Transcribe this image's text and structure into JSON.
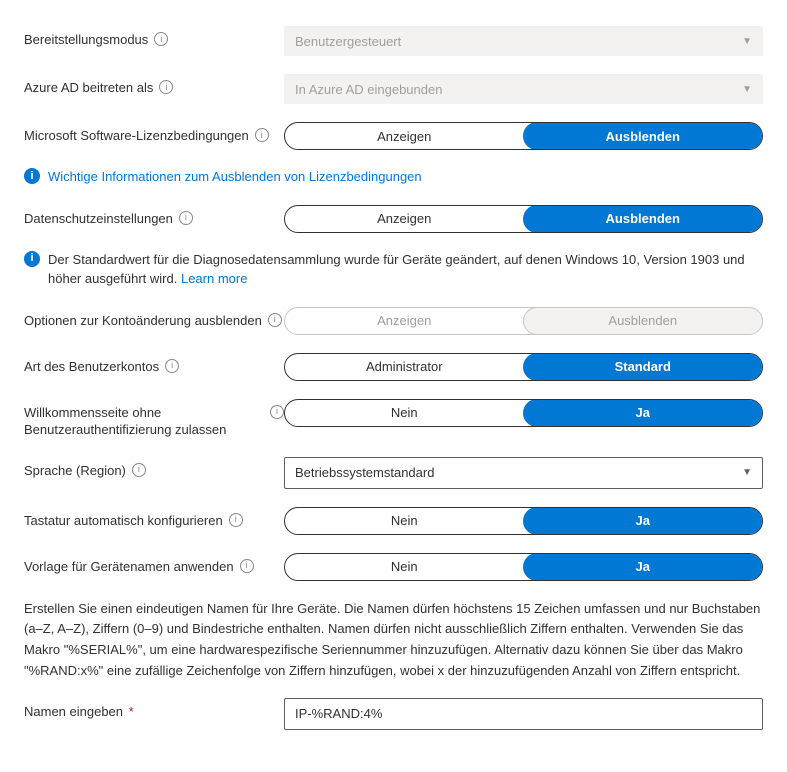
{
  "rows": {
    "deployMode": {
      "label": "Bereitstellungsmodus",
      "value": "Benutzergesteuert"
    },
    "azureAdJoin": {
      "label": "Azure AD beitreten als",
      "value": "In Azure AD eingebunden"
    },
    "eula": {
      "label": "Microsoft Software-Lizenzbedingungen",
      "optA": "Anzeigen",
      "optB": "Ausblenden"
    },
    "privacy": {
      "label": "Datenschutzeinstellungen",
      "optA": "Anzeigen",
      "optB": "Ausblenden"
    },
    "acctChange": {
      "label": "Optionen zur Kontoänderung ausblenden",
      "optA": "Anzeigen",
      "optB": "Ausblenden"
    },
    "acctType": {
      "label": "Art des Benutzerkontos",
      "optA": "Administrator",
      "optB": "Standard"
    },
    "whiteGlove": {
      "label": "Willkommensseite ohne Benutzerauthentifizierung zulassen",
      "optA": "Nein",
      "optB": "Ja"
    },
    "language": {
      "label": "Sprache (Region)",
      "value": "Betriebssystemstandard"
    },
    "keyboard": {
      "label": "Tastatur automatisch konfigurieren",
      "optA": "Nein",
      "optB": "Ja"
    },
    "nameTmpl": {
      "label": "Vorlage für Gerätenamen anwenden",
      "optA": "Nein",
      "optB": "Ja"
    },
    "nameInput": {
      "label": "Namen eingeben",
      "value": "IP-%RAND:4%"
    }
  },
  "info": {
    "eulaHide": "Wichtige Informationen zum Ausblenden von Lizenzbedingungen",
    "diagText": "Der Standardwert für die Diagnosedatensammlung wurde für Geräte geändert, auf denen Windows 10, Version 1903 und höher ausgeführt wird. ",
    "diagLink": "Learn more"
  },
  "para": "Erstellen Sie einen eindeutigen Namen für Ihre Geräte. Die Namen dürfen höchstens 15 Zeichen umfassen und nur Buchstaben (a–Z, A–Z), Ziffern (0–9) und Bindestriche enthalten. Namen dürfen nicht ausschließlich Ziffern enthalten. Verwenden Sie das Makro \"%SERIAL%\", um eine hardwarespezifische Seriennummer hinzuzufügen. Alternativ dazu können Sie über das Makro \"%RAND:x%\" eine zufällige Zeichenfolge von Ziffern hinzufügen, wobei x der hinzuzufügenden Anzahl von Ziffern entspricht."
}
